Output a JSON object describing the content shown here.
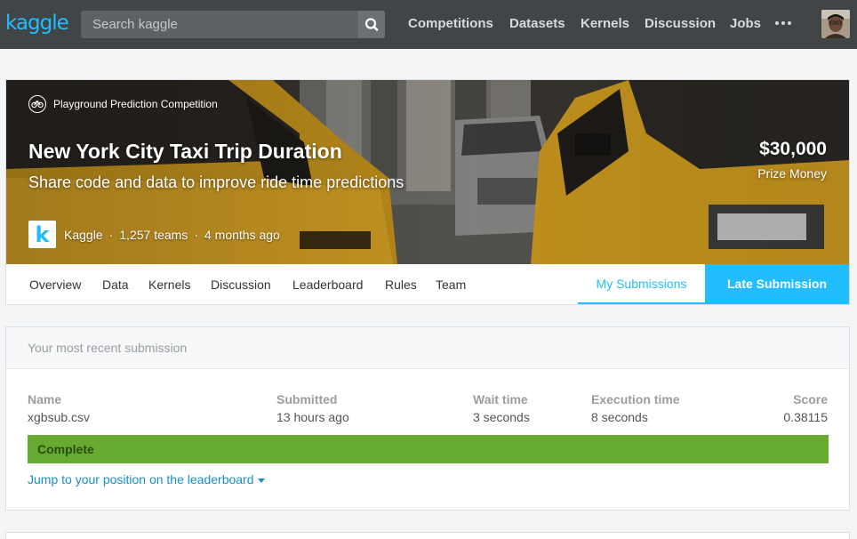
{
  "topbar": {
    "logo_text": "kaggle",
    "search": {
      "placeholder": "Search kaggle",
      "icon": "search-icon"
    },
    "nav": [
      "Competitions",
      "Datasets",
      "Kernels",
      "Discussion",
      "Jobs"
    ],
    "more_icon": "more-dots-icon",
    "avatar_icon": "user-avatar",
    "background_color": "#424547",
    "accent_color": "#20beff"
  },
  "competition": {
    "category": "Playground Prediction Competition",
    "category_icon": "bicycle-icon",
    "title": "New York City Taxi Trip Duration",
    "subtitle": "Share code and data to improve ride time predictions",
    "prize_amount": "$30,000",
    "prize_label": "Prize Money",
    "host_logo_letter": "k",
    "host": "Kaggle",
    "separator": "·",
    "teams": "1,257 teams",
    "age": "4 months ago"
  },
  "tabs": {
    "items": [
      "Overview",
      "Data",
      "Kernels",
      "Discussion",
      "Leaderboard",
      "Rules",
      "Team"
    ],
    "my_submissions": "My Submissions",
    "late_submission": "Late Submission"
  },
  "submission": {
    "panel_title": "Your most recent submission",
    "headers": {
      "name": "Name",
      "submitted": "Submitted",
      "wait": "Wait time",
      "execution": "Execution time",
      "score": "Score"
    },
    "values": {
      "name": "xgbsub.csv",
      "submitted": "13 hours ago",
      "wait": "3 seconds",
      "execution": "8 seconds",
      "score": "0.38115"
    },
    "status": "Complete",
    "status_color": "#66ab30",
    "jump_link": "Jump to your position on the leaderboard",
    "jump_icon": "caret-down-icon"
  }
}
